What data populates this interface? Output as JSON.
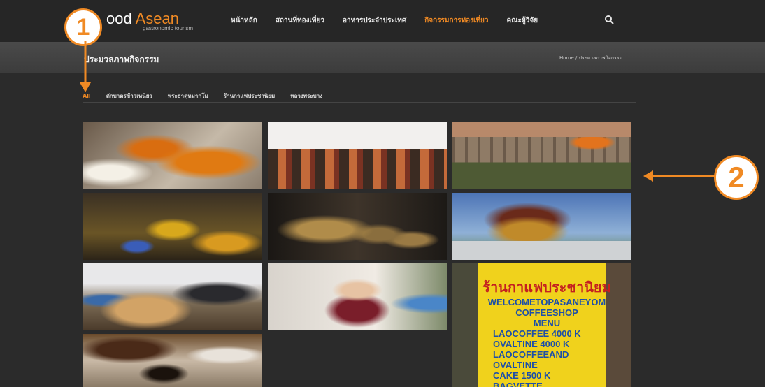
{
  "header": {
    "logo_prefix": "ood ",
    "logo_accent": "Asean",
    "logo_sub": "gastronomic tourism",
    "nav": [
      {
        "label": "หน้าหลัก",
        "active": false
      },
      {
        "label": "สถานที่ท่องเที่ยว",
        "active": false
      },
      {
        "label": "อาหารประจำประเทศ",
        "active": false
      },
      {
        "label": "กิจกรรมการท่องเที่ยว",
        "active": true
      },
      {
        "label": "คณะผู้วิจัย",
        "active": false
      }
    ],
    "search_icon": "search-icon"
  },
  "title_band": {
    "title": "ประมวลภาพกิจกรรม",
    "breadcrumb": "Home / ประมวลภาพกิจกรรม"
  },
  "filters": [
    {
      "label": "All",
      "active": true
    },
    {
      "label": "ตักบาตรข้าวเหนียว",
      "active": false
    },
    {
      "label": "พระธาตุหมากโม",
      "active": false
    },
    {
      "label": "ร้านกาแฟประชานิยม",
      "active": false
    },
    {
      "label": "หลวงพระบาง",
      "active": false
    }
  ],
  "gallery": {
    "sign": {
      "thai": "ร้านกาแฟประชานิยม",
      "lines": [
        "WELCOMETOPASANEYOM",
        "COFFEESHOP",
        "MENU",
        "LAOCOFFEE 4000 K",
        "OVALTINE 4000 K",
        "LAOCOFFEEAND",
        "OVALTINE",
        "CAKE 1500 K",
        "BAGVETTE"
      ]
    }
  },
  "annotations": {
    "callout_1": "1",
    "callout_2": "2"
  },
  "colors": {
    "accent": "#f08a24",
    "background": "#2b2b2b"
  }
}
